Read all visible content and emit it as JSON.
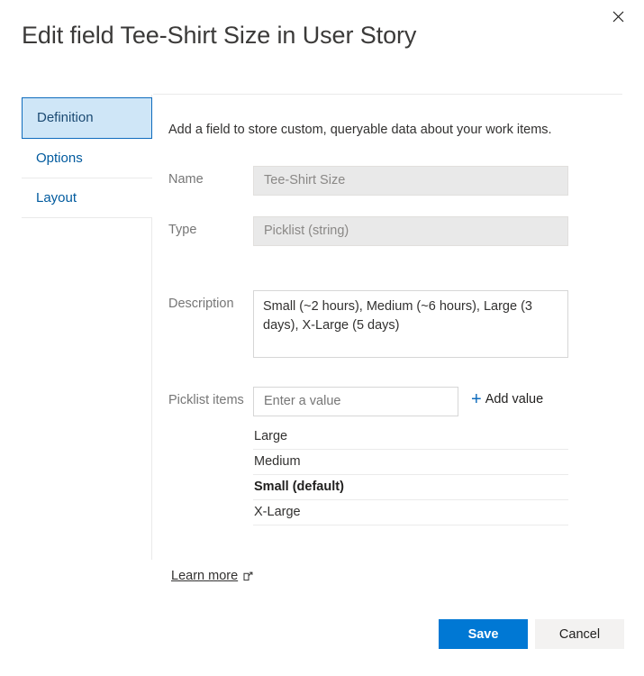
{
  "dialog": {
    "title": "Edit field Tee-Shirt Size in User Story",
    "close_icon": "close-icon"
  },
  "sidebar": {
    "items": [
      {
        "label": "Definition",
        "selected": true
      },
      {
        "label": "Options",
        "selected": false
      },
      {
        "label": "Layout",
        "selected": false
      }
    ]
  },
  "content": {
    "intro": "Add a field to store custom, queryable data about your work items.",
    "fields": {
      "name": {
        "label": "Name",
        "value": "Tee-Shirt Size",
        "disabled": true
      },
      "type": {
        "label": "Type",
        "value": "Picklist (string)",
        "disabled": true
      },
      "description": {
        "label": "Description",
        "value": "Small (~2 hours), Medium (~6 hours), Large (3 days), X-Large (5 days)"
      },
      "picklist": {
        "label": "Picklist items",
        "input_value": "",
        "placeholder": "Enter a value",
        "add_value_label": "Add value",
        "add_value_icon": "plus-icon",
        "items": [
          {
            "label": "Large",
            "is_default": false
          },
          {
            "label": "Medium",
            "is_default": false
          },
          {
            "label": "Small (default)",
            "is_default": true
          },
          {
            "label": "X-Large",
            "is_default": false
          }
        ]
      }
    },
    "learn_more": {
      "label": "Learn more",
      "icon": "external-link-icon"
    }
  },
  "footer": {
    "save_label": "Save",
    "cancel_label": "Cancel"
  },
  "colors": {
    "accent": "#0078d4",
    "selected_nav_bg": "#cfe6f7",
    "selected_nav_border": "#0f6cbd",
    "link": "#005a9e",
    "cancel_bg": "#f3f2f1",
    "disabled_input_bg": "#e9e9e9"
  }
}
